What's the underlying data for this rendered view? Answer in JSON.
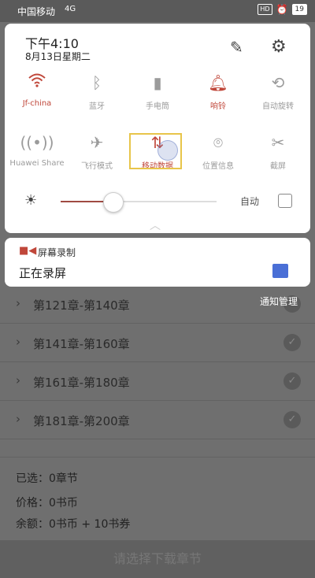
{
  "status_bar": {
    "carrier": "中国移动",
    "signal": "4G",
    "hd": "HD",
    "battery": "19"
  },
  "quick_settings": {
    "time": "下午4:10",
    "date": "8月13日星期二",
    "tiles": [
      {
        "label": "Jf-china",
        "icon": "wifi-icon",
        "state": "on"
      },
      {
        "label": "蓝牙",
        "icon": "bluetooth-icon",
        "state": "off"
      },
      {
        "label": "手电筒",
        "icon": "flashlight-icon",
        "state": "off"
      },
      {
        "label": "响铃",
        "icon": "bell-icon",
        "state": "on"
      },
      {
        "label": "自动旋转",
        "icon": "rotate-icon",
        "state": "off"
      },
      {
        "label": "Huawei Share",
        "icon": "share-icon",
        "state": "off"
      },
      {
        "label": "飞行模式",
        "icon": "airplane-icon",
        "state": "off"
      },
      {
        "label": "移动数据",
        "icon": "mobile-data-icon",
        "state": "on"
      },
      {
        "label": "位置信息",
        "icon": "location-icon",
        "state": "off"
      },
      {
        "label": "截屏",
        "icon": "screenshot-icon",
        "state": "off"
      }
    ],
    "brightness_fraction": 0.34,
    "auto_label": "自动",
    "auto_checked": false
  },
  "notification": {
    "app_name": "屏幕录制",
    "text": "正在录屏"
  },
  "notification_manage": "通知管理",
  "background": {
    "chapters": [
      "第121章-第140章",
      "第141章-第160章",
      "第161章-第180章",
      "第181章-第200章"
    ],
    "selected": "已选：0章节",
    "price": "价格：0书币",
    "balance": "余额：0书币 + 10书券",
    "download_button": "请选择下载章节"
  },
  "colors": {
    "accent_on": "#c0473a",
    "tile_off": "#9b9b9b",
    "highlight": "#e8c54a",
    "stop_button": "#4a6fd6"
  }
}
